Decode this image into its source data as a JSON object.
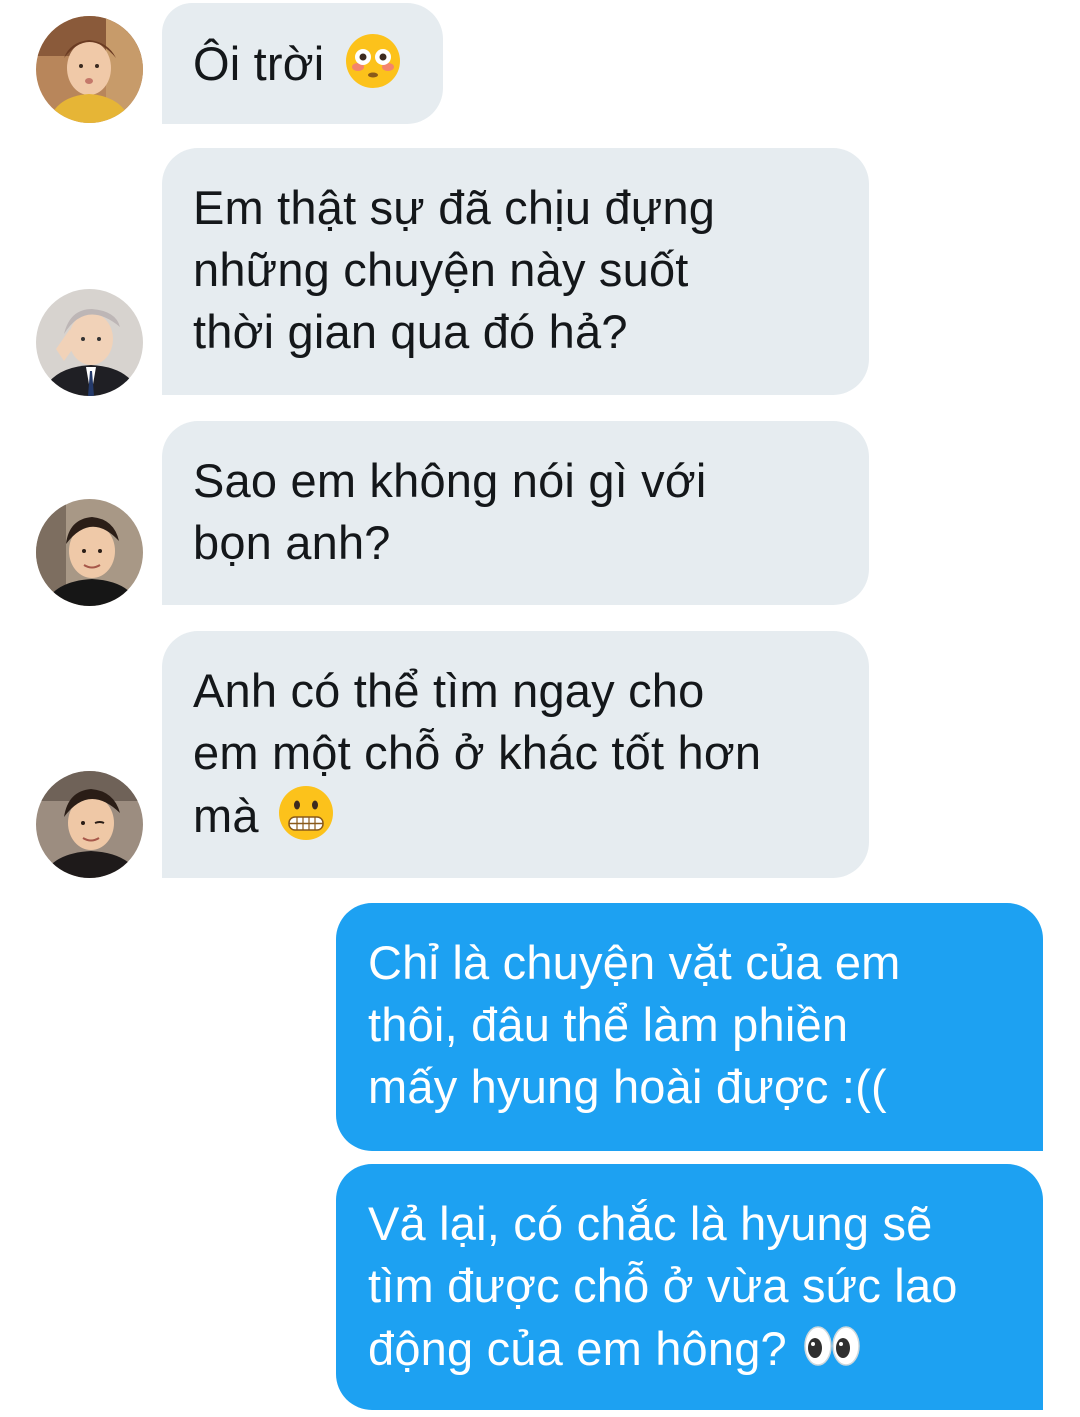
{
  "conversation": {
    "messages": [
      {
        "direction": "incoming",
        "avatar": "avatar-1",
        "lines": [
          "Ôi trời"
        ],
        "emoji": "flushed-face-emoji"
      },
      {
        "direction": "incoming",
        "avatar": "avatar-2",
        "lines": [
          "Em thật sự đã chịu đựng",
          "những chuyện này suốt",
          "thời gian qua đó hả?"
        ]
      },
      {
        "direction": "incoming",
        "avatar": "avatar-3",
        "lines": [
          "Sao em không nói gì với",
          "bọn anh?"
        ]
      },
      {
        "direction": "incoming",
        "avatar": "avatar-4",
        "lines": [
          "Anh có thể tìm ngay cho",
          "em một chỗ ở khác tốt hơn",
          "mà"
        ],
        "emoji": "grimacing-face-emoji"
      },
      {
        "direction": "outgoing",
        "lines": [
          "Chỉ là chuyện vặt của em",
          "thôi, đâu thể làm phiền",
          "mấy hyung hoài được :(("
        ]
      },
      {
        "direction": "outgoing",
        "lines": [
          "Vả lại, có chắc là hyung sẽ",
          "tìm được chỗ ở vừa sức lao",
          "động của em hông?"
        ],
        "emoji": "eyes-emoji"
      }
    ]
  },
  "colors": {
    "incoming_bubble": "#e6ecf0",
    "incoming_text": "#14171a",
    "outgoing_bubble": "#1da1f2",
    "outgoing_text": "#ffffff"
  }
}
